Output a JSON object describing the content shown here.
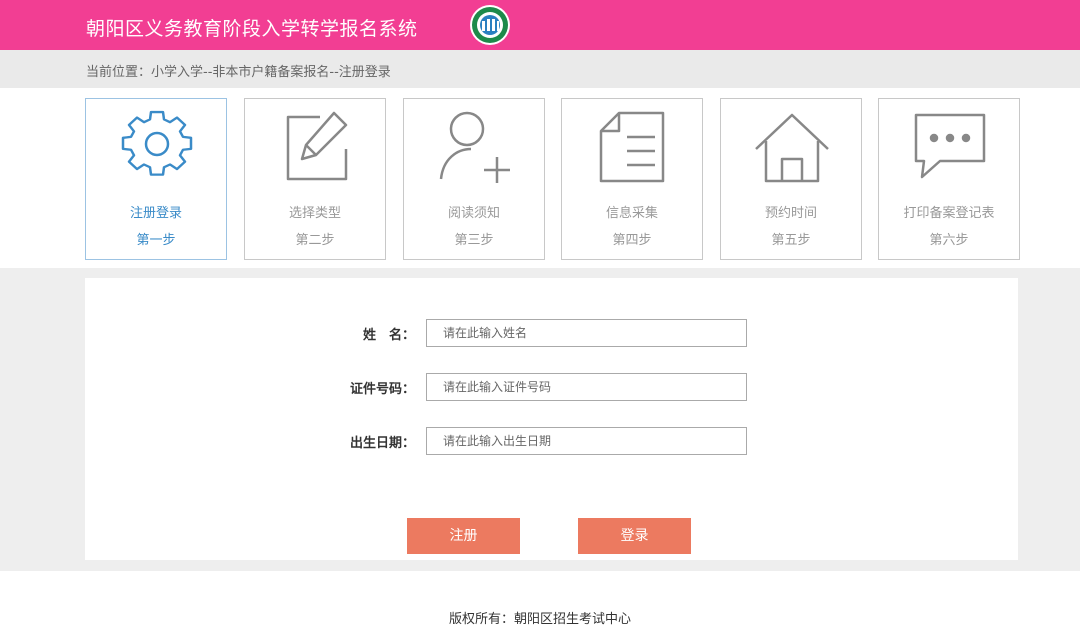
{
  "header": {
    "title": "朝阳区义务教育阶段入学转学报名系统"
  },
  "breadcrumb": {
    "text": "当前位置：小学入学--非本市户籍备案报名--注册登录"
  },
  "steps": [
    {
      "label": "注册登录",
      "sub": "第一步",
      "icon": "gear-icon",
      "active": true
    },
    {
      "label": "选择类型",
      "sub": "第二步",
      "icon": "edit-icon",
      "active": false
    },
    {
      "label": "阅读须知",
      "sub": "第三步",
      "icon": "add-user-icon",
      "active": false
    },
    {
      "label": "信息采集",
      "sub": "第四步",
      "icon": "document-icon",
      "active": false
    },
    {
      "label": "预约时间",
      "sub": "第五步",
      "icon": "home-icon",
      "active": false
    },
    {
      "label": "打印备案登记表",
      "sub": "第六步",
      "icon": "chat-icon",
      "active": false
    }
  ],
  "form": {
    "name_label": "姓　名：",
    "name_placeholder": "请在此输入姓名",
    "id_label": "证件号码：",
    "id_placeholder": "请在此输入证件号码",
    "birth_label": "出生日期：",
    "birth_placeholder": "请在此输入出生日期",
    "register_label": "注册",
    "login_label": "登录"
  },
  "footer": {
    "text": "版权所有：朝阳区招生考试中心"
  },
  "colors": {
    "header": "#f23e93",
    "button": "#ec7a60",
    "active": "#3a8bc8"
  }
}
